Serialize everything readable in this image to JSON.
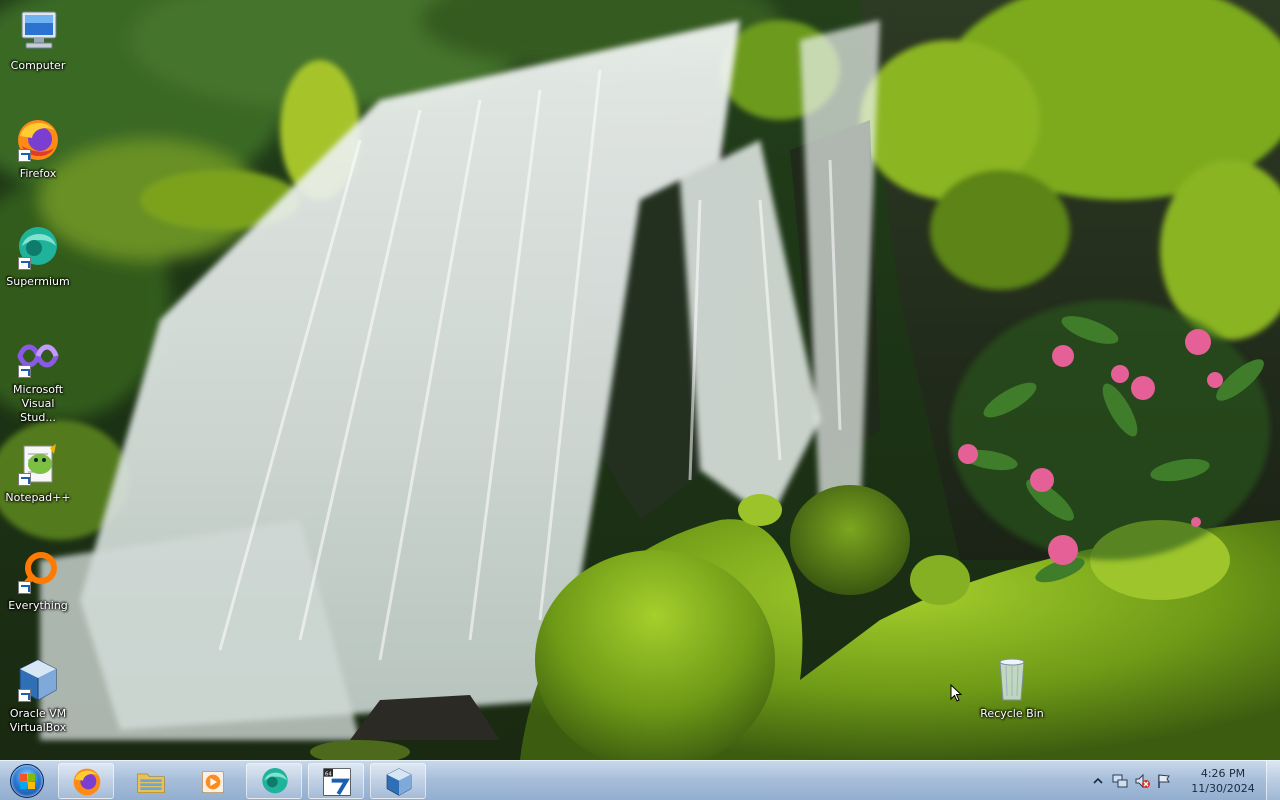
{
  "desktop": {
    "icons": [
      {
        "label": "Computer",
        "icon": "computer-icon",
        "shortcut": false
      },
      {
        "label": "Firefox",
        "icon": "firefox-icon",
        "shortcut": true
      },
      {
        "label": "Supermium",
        "icon": "supermium-icon",
        "shortcut": true
      },
      {
        "label": "Microsoft Visual Stud...",
        "icon": "visual-studio-icon",
        "shortcut": true
      },
      {
        "label": "Notepad++",
        "icon": "notepad-plus-plus-icon",
        "shortcut": true
      },
      {
        "label": "Everything",
        "icon": "everything-search-icon",
        "shortcut": true
      },
      {
        "label": "Oracle VM VirtualBox",
        "icon": "virtualbox-icon",
        "shortcut": true
      },
      {
        "label": "Recycle Bin",
        "icon": "recycle-bin-icon",
        "shortcut": false
      }
    ]
  },
  "taskbar": {
    "start": {
      "icon": "windows-start-orb-icon"
    },
    "buttons": [
      {
        "name": "Firefox",
        "icon": "firefox-icon",
        "active": true
      },
      {
        "name": "Windows Explorer",
        "icon": "folder-explorer-icon",
        "active": false
      },
      {
        "name": "Windows Media Player",
        "icon": "media-player-icon",
        "active": false
      },
      {
        "name": "Supermium",
        "icon": "supermium-icon",
        "active": true
      },
      {
        "name": "7-Zip 64",
        "icon": "seven-zip-icon",
        "active": true
      },
      {
        "name": "Oracle VM VirtualBox",
        "icon": "virtualbox-icon",
        "active": true
      }
    ],
    "tray": {
      "icons": [
        "chevron-up-icon",
        "network-icon",
        "volume-muted-icon",
        "action-center-flag-icon"
      ],
      "time": "4:26 PM",
      "date": "11/30/2024"
    }
  },
  "colors": {
    "taskbar": "#a8bfdb",
    "moss": "#6a9a1e",
    "flower": "#e8609a"
  }
}
